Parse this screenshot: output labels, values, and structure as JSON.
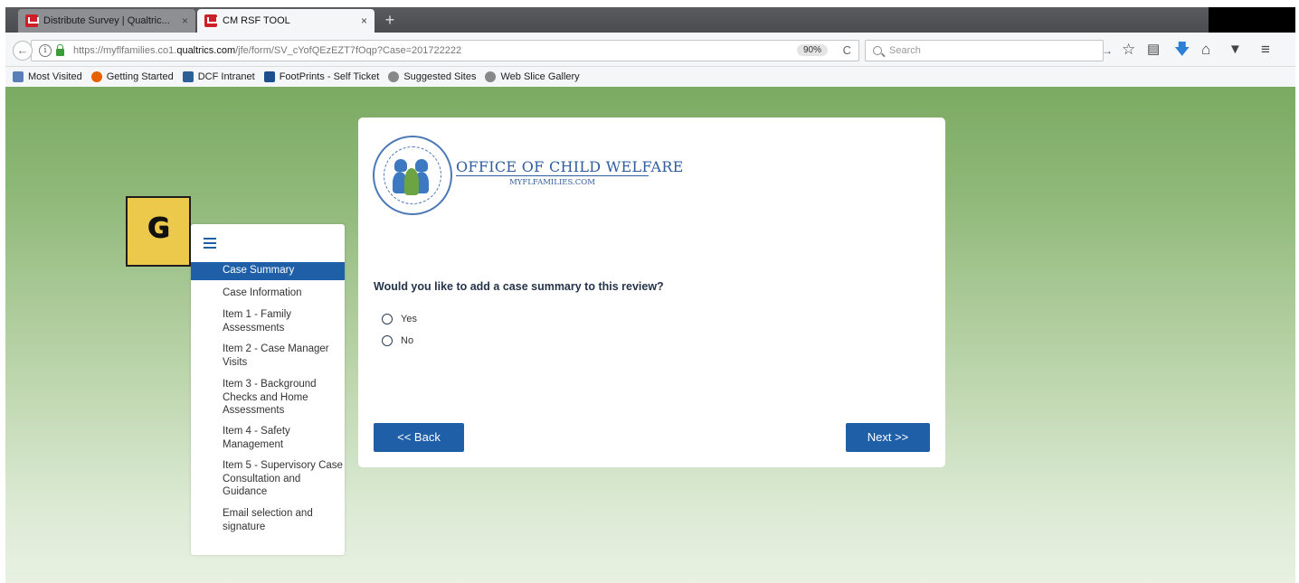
{
  "browser": {
    "tabs": [
      {
        "title": "Distribute Survey | Qualtric...",
        "close": "×"
      },
      {
        "title": "CM RSF TOOL",
        "close": "×"
      }
    ],
    "new_tab": "+",
    "url_prefix": "https://myflfamilies.co1.",
    "url_domain": "qualtrics.com",
    "url_path": "/jfe/form/SV_cYofQEzEZT7fOqp?Case=201722222",
    "zoom": "90%",
    "reload": "C",
    "search_placeholder": "Search",
    "bookmarks": [
      {
        "label": "Most Visited",
        "icon": "bookmarks-folder-icon",
        "color": "#5a7fb8"
      },
      {
        "label": "Getting Started",
        "icon": "firefox-icon",
        "color": "#e66000"
      },
      {
        "label": "DCF Intranet",
        "icon": "dcf-icon",
        "color": "#2d5f99"
      },
      {
        "label": "FootPrints - Self Ticket",
        "icon": "footprints-icon",
        "color": "#1d4f8f"
      },
      {
        "label": "Suggested Sites",
        "icon": "web-globe-icon",
        "color": "#888888"
      },
      {
        "label": "Web Slice Gallery",
        "icon": "web-globe-icon",
        "color": "#888888"
      }
    ]
  },
  "annotation": {
    "letter": "G"
  },
  "sidebar": {
    "items": [
      {
        "label": "Case Summary",
        "active": true
      },
      {
        "label": "Case Information"
      },
      {
        "label": "Item 1 - Family Assessments"
      },
      {
        "label": "Item 2 - Case Manager Visits"
      },
      {
        "label": "Item 3 - Background Checks and Home Assessments"
      },
      {
        "label": "Item 4 - Safety Management"
      },
      {
        "label": "Item 5 - Supervisory Case Consultation and Guidance"
      },
      {
        "label": "Email selection and signature"
      }
    ]
  },
  "logo": {
    "title": "OFFICE OF CHILD WELFARE",
    "subtitle": "MYFLFAMILIES.COM"
  },
  "question": {
    "text": "Would you like to add a case summary to this review?",
    "choices": [
      "Yes",
      "No"
    ]
  },
  "buttons": {
    "back": "<< Back",
    "next": "Next >>"
  },
  "colors": {
    "accent": "#1f5fa8",
    "badge": "#ecc94a"
  }
}
